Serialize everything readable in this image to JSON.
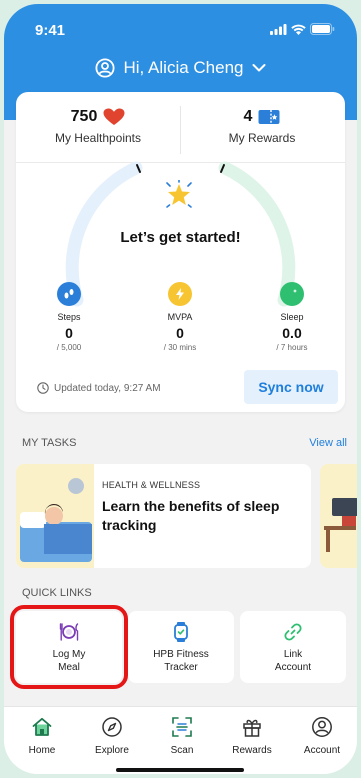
{
  "status": {
    "time": "9:41"
  },
  "header": {
    "greeting": "Hi, Alicia Cheng"
  },
  "summary": {
    "healthpoints_value": "750",
    "healthpoints_label": "My Healthpoints",
    "rewards_value": "4",
    "rewards_label": "My Rewards",
    "headline": "Let’s get started!"
  },
  "metrics": [
    {
      "name": "Steps",
      "value": "0",
      "goal": "/ 5,000",
      "color": "#2b7fd9"
    },
    {
      "name": "MVPA",
      "value": "0",
      "goal": "/ 30 mins",
      "color": "#f7c531"
    },
    {
      "name": "Sleep",
      "value": "0.0",
      "goal": "/ 7 hours",
      "color": "#2fbf71"
    }
  ],
  "updated": "Updated today, 9:27 AM",
  "sync_label": "Sync now",
  "tasks": {
    "title": "MY TASKS",
    "view_all": "View all",
    "items": [
      {
        "category": "HEALTH & WELLNESS",
        "title": "Learn the benefits of sleep tracking"
      }
    ]
  },
  "quick_links": {
    "title": "QUICK LINKS",
    "items": [
      {
        "label_line1": "Log My",
        "label_line2": "Meal",
        "icon": "meal-plate-icon"
      },
      {
        "label_line1": "HPB Fitness",
        "label_line2": "Tracker",
        "icon": "watch-icon"
      },
      {
        "label_line1": "Link",
        "label_line2": "Account",
        "icon": "link-icon"
      }
    ]
  },
  "nav": [
    {
      "label": "Home",
      "icon": "home-icon"
    },
    {
      "label": "Explore",
      "icon": "compass-icon"
    },
    {
      "label": "Scan",
      "icon": "scan-icon"
    },
    {
      "label": "Rewards",
      "icon": "gift-icon"
    },
    {
      "label": "Account",
      "icon": "user-icon"
    }
  ],
  "colors": {
    "brand_blue": "#2d8fe2",
    "accent_red": "#e51616",
    "link_blue": "#1f7fdc"
  }
}
